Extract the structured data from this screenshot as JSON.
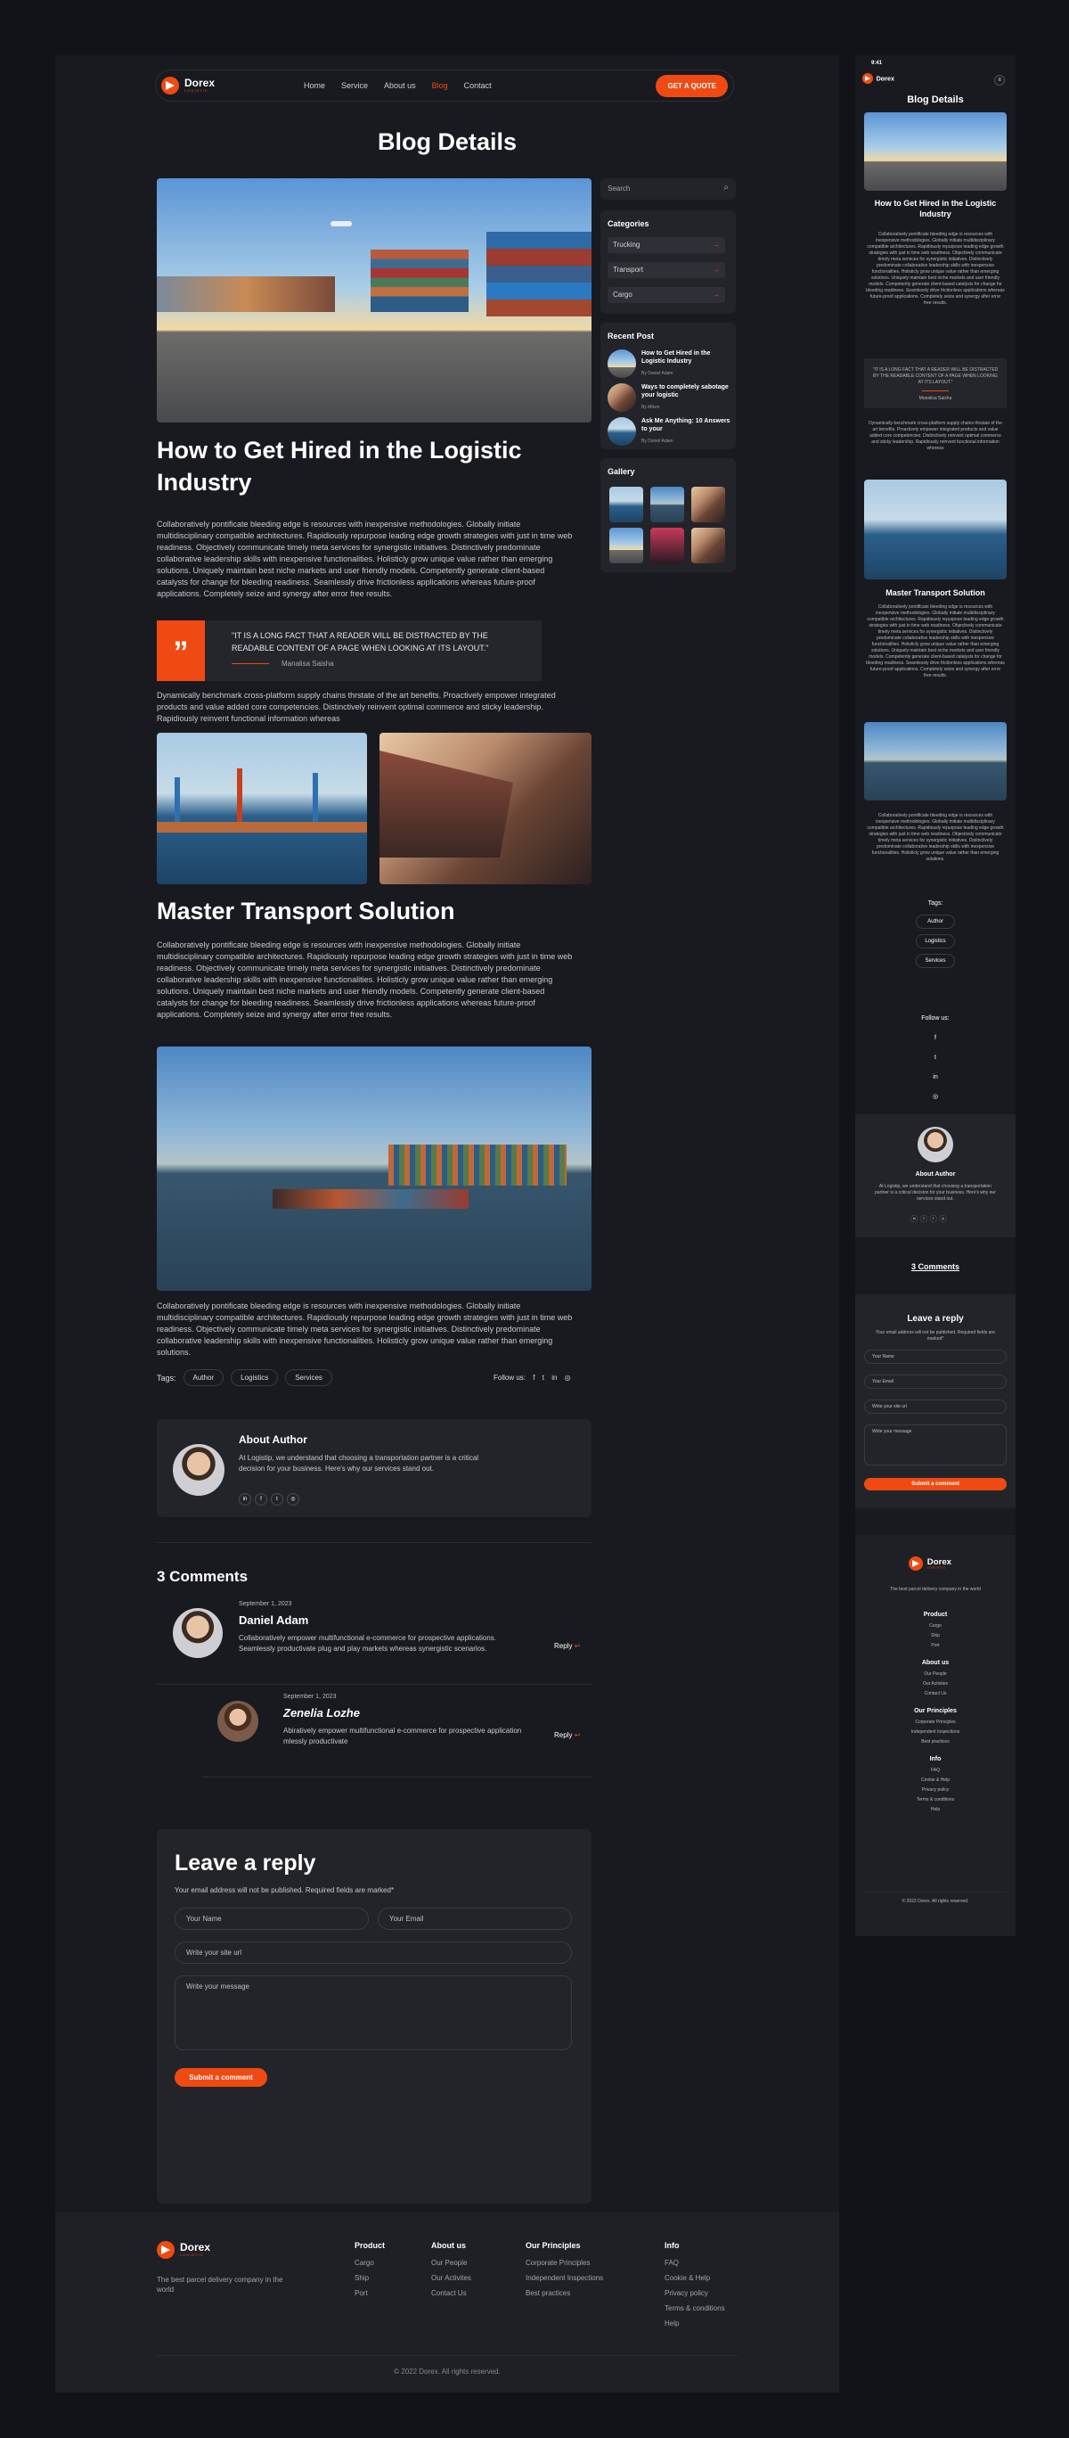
{
  "brand": {
    "name": "Dorex",
    "tagline": "LOGISTIC"
  },
  "nav": {
    "items": [
      "Home",
      "Service",
      "About us",
      "Blog",
      "Contact"
    ],
    "active": "Blog",
    "cta": "GET A QUOTE"
  },
  "page_title": "Blog Details",
  "post": {
    "title": "How to Get Hired in the Logistic Industry",
    "intro": "Collaboratively pontificate bleeding edge is resources with inexpensive methodologies. Globally initiate multidisciplinary compatible architectures. Rapidiously repurpose leading edge growth strategies with just in time web readiness. Objectively communicate timely meta services for synergistic initiatives. Distinctively predominate collaborative leadership skills with inexpensive functionalities. Holisticly grow unique value rather than emerging solutions. Uniquely maintain best niche markets and user friendly models. Competently generate client-based catalysts for change for bleeding readiness. Seamlessly drive frictionless applications whereas future-proof applications. Completely seize and synergy after error free results.",
    "quote": "\"IT IS A LONG FACT THAT A READER WILL BE DISTRACTED BY THE READABLE CONTENT OF A PAGE WHEN LOOKING AT ITS LAYOUT.\"",
    "quote_author": "Manalisa Saisha",
    "para2": "Dynamically benchmark cross-platform supply chains thrstate of the art benefits. Proactively empower integrated products and value added core competencies. Distinctively reinvent optimal commerce and sticky leadership. Rapidiously reinvent functional information whereas",
    "subtitle": "Master Transport Solution",
    "para3": "Collaboratively pontificate bleeding edge is resources with inexpensive methodologies. Globally initiate multidisciplinary compatible architectures. Rapidiously repurpose leading edge growth strategies with just in time web readiness. Objectively communicate timely meta services for synergistic initiatives. Distinctively predominate collaborative leadership skills with inexpensive functionalities. Holisticly grow unique value rather than emerging solutions. Uniquely maintain best niche markets and user friendly models. Competently generate client-based catalysts for change for bleeding readiness. Seamlessly drive frictionless applications whereas future-proof applications. Completely seize and synergy after error free results.",
    "para4": "Collaboratively pontificate bleeding edge is resources with inexpensive methodologies. Globally initiate multidisciplinary compatible architectures. Rapidiously repurpose leading edge growth strategies with just in time web readiness. Objectively communicate timely meta services for synergistic initiatives. Distinctively predominate collaborative leadership skills with inexpensive functionalities. Holisticly grow unique value rather than emerging solutions.",
    "tags_label": "Tags:",
    "tags": [
      "Author",
      "Logistics",
      "Services"
    ],
    "follow_label": "Follow us:"
  },
  "sidebar": {
    "search_placeholder": "Search",
    "categories_title": "Categories",
    "categories": [
      "Trucking",
      "Transport",
      "Cargo"
    ],
    "recent_title": "Recent Post",
    "recent": [
      {
        "title": "How to Get Hired in the Logistic Industry",
        "by": "By Daniel Adam"
      },
      {
        "title": "Ways to completely sabotage your logistic",
        "by": "By Miken"
      },
      {
        "title": "Ask Me Anything: 10 Answers to your",
        "by": "By Daniel Adam"
      }
    ],
    "gallery_title": "Gallery"
  },
  "author": {
    "title": "About Author",
    "bio": "At Logistip, we understand that choosing a transportation partner is a critical decision for your business. Here's why our services stand out."
  },
  "comments": {
    "title": "3 Comments",
    "items": [
      {
        "date": "September 1, 2023",
        "name": "Daniel Adam",
        "text": "Collaboratively empower multifunctional e-commerce for prospective applications. Seamlessly productivate plug and play markets whereas synergistic scenarios.",
        "reply": "Reply"
      },
      {
        "date": "September 1, 2023",
        "name": "Zenelia Lozhe",
        "text": "Abiratively empower multifunctional e-commerce for prospective application mlessly productivate",
        "reply": "Reply"
      }
    ]
  },
  "reply": {
    "title": "Leave a reply",
    "note": "Your email address will not be published. Required fields are marked*",
    "name_ph": "Your Name",
    "email_ph": "Your Email",
    "site_ph": "Write your site url",
    "msg_ph": "Write your message",
    "submit": "Submit a comment"
  },
  "footer": {
    "tagline": "The best parcel delivery company in the world",
    "cols": [
      {
        "title": "Product",
        "items": [
          "Cargo",
          "Ship",
          "Port"
        ]
      },
      {
        "title": "About us",
        "items": [
          "Our People",
          "Our Activites",
          "Contact Us"
        ]
      },
      {
        "title": "Our Principles",
        "items": [
          "Corporate Principles",
          "Independent Inspections",
          "Best practices"
        ]
      },
      {
        "title": "Info",
        "items": [
          "FAQ",
          "Cookie & Help",
          "Privacy policy",
          "Terms & conditions",
          "Help"
        ]
      }
    ],
    "copyright": "© 2022 Dorex. All rights reserved."
  },
  "mobile": {
    "time": "9:41",
    "about_author_short": "At Logistip, we understand that choosing a transportation partner is a critical decision for your business. Here's why our services stand out.",
    "follow_label": "Follow us:",
    "tags_label": "Tags:",
    "mob_para": "Dynamically benchmark cross-platform supply chains thrstate of the art benefits. Proactively empower integrated products and value added core competencies. Distinctively reinvent optimal commerce and sticky leadership. Rapidiously reinvent functional information whereas",
    "mob_copyright": "© 2022 Dorex. All rights reserved."
  }
}
